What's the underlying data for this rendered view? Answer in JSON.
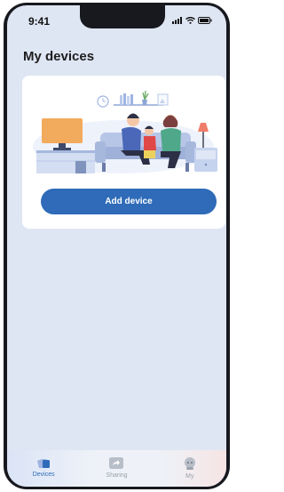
{
  "status_bar": {
    "time": "9:41"
  },
  "page": {
    "title": "My devices"
  },
  "card": {
    "button_label": "Add device"
  },
  "tabbar": {
    "tabs": [
      {
        "label": "Devices",
        "icon": "devices-icon",
        "active": true
      },
      {
        "label": "Sharing",
        "icon": "share-icon",
        "active": false
      },
      {
        "label": "My",
        "icon": "profile-icon",
        "active": false
      }
    ]
  },
  "colors": {
    "accent": "#2f6bb8",
    "background": "#dfe6f3",
    "card": "#ffffff"
  }
}
